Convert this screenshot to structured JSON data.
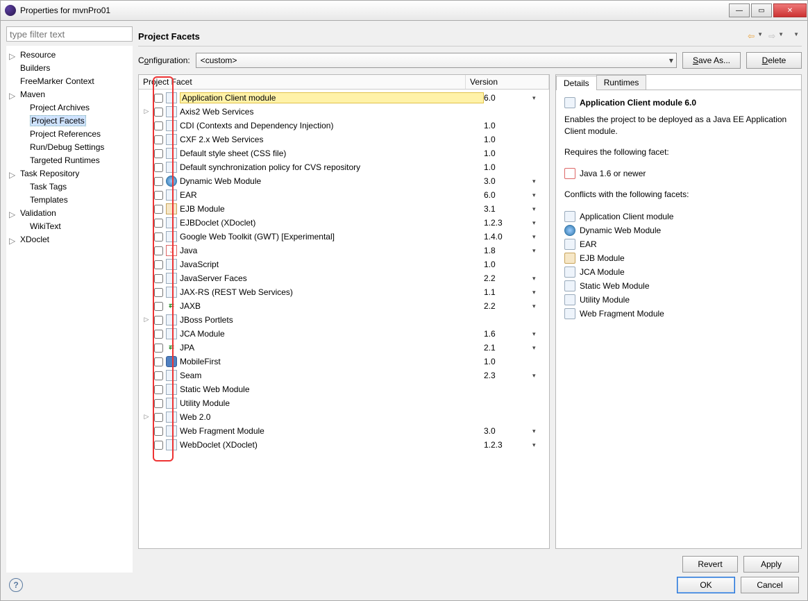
{
  "window": {
    "title": "Properties for mvnPro01"
  },
  "nav": {
    "filter_placeholder": "type filter text",
    "items": [
      {
        "label": "Resource",
        "expandable": true
      },
      {
        "label": "Builders"
      },
      {
        "label": "FreeMarker Context"
      },
      {
        "label": "Maven",
        "expandable": true
      },
      {
        "label": "Project Archives",
        "indent": true
      },
      {
        "label": "Project Facets",
        "indent": true,
        "selected": true
      },
      {
        "label": "Project References",
        "indent": true
      },
      {
        "label": "Run/Debug Settings",
        "indent": true
      },
      {
        "label": "Targeted Runtimes",
        "indent": true
      },
      {
        "label": "Task Repository",
        "expandable": true
      },
      {
        "label": "Task Tags",
        "indent": true
      },
      {
        "label": "Templates",
        "indent": true
      },
      {
        "label": "Validation",
        "expandable": true
      },
      {
        "label": "WikiText",
        "indent": true
      },
      {
        "label": "XDoclet",
        "expandable": true
      }
    ]
  },
  "header": {
    "title": "Project Facets"
  },
  "config": {
    "label_pre": "C",
    "label_u": "o",
    "label_post": "nfiguration:",
    "value": "<custom>",
    "save_pre": "",
    "save_u": "S",
    "save_post": "ave As...",
    "del_pre": "",
    "del_u": "D",
    "del_post": "elete"
  },
  "facets": {
    "col_facet": "Project Facet",
    "col_version": "Version",
    "rows": [
      {
        "name": "Application Client module",
        "ver": "6.0",
        "dd": true,
        "icon": "doc",
        "highlight": true
      },
      {
        "name": "Axis2 Web Services",
        "icon": "doc",
        "expandable": true
      },
      {
        "name": "CDI (Contexts and Dependency Injection)",
        "ver": "1.0",
        "icon": "doc"
      },
      {
        "name": "CXF 2.x Web Services",
        "ver": "1.0",
        "icon": "doc"
      },
      {
        "name": "Default style sheet (CSS file)",
        "ver": "1.0",
        "icon": "doc"
      },
      {
        "name": "Default synchronization policy for CVS repository",
        "ver": "1.0",
        "icon": "doc"
      },
      {
        "name": "Dynamic Web Module",
        "ver": "3.0",
        "dd": true,
        "icon": "globe"
      },
      {
        "name": "EAR",
        "ver": "6.0",
        "dd": true,
        "icon": "doc"
      },
      {
        "name": "EJB Module",
        "ver": "3.1",
        "dd": true,
        "icon": "jar"
      },
      {
        "name": "EJBDoclet (XDoclet)",
        "ver": "1.2.3",
        "dd": true,
        "icon": "doc"
      },
      {
        "name": "Google Web Toolkit (GWT) [Experimental]",
        "ver": "1.4.0",
        "dd": true,
        "icon": "doc"
      },
      {
        "name": "Java",
        "ver": "1.8",
        "dd": true,
        "icon": "java"
      },
      {
        "name": "JavaScript",
        "ver": "1.0",
        "icon": "doc"
      },
      {
        "name": "JavaServer Faces",
        "ver": "2.2",
        "dd": true,
        "icon": "doc"
      },
      {
        "name": "JAX-RS (REST Web Services)",
        "ver": "1.1",
        "dd": true,
        "icon": "doc"
      },
      {
        "name": "JAXB",
        "ver": "2.2",
        "dd": true,
        "icon": "arrow"
      },
      {
        "name": "JBoss Portlets",
        "icon": "doc",
        "expandable": true
      },
      {
        "name": "JCA Module",
        "ver": "1.6",
        "dd": true,
        "icon": "doc"
      },
      {
        "name": "JPA",
        "ver": "2.1",
        "dd": true,
        "icon": "arrow"
      },
      {
        "name": "MobileFirst",
        "ver": "1.0",
        "icon": "db"
      },
      {
        "name": "Seam",
        "ver": "2.3",
        "dd": true,
        "icon": "doc"
      },
      {
        "name": "Static Web Module",
        "icon": "doc"
      },
      {
        "name": "Utility Module",
        "icon": "doc"
      },
      {
        "name": "Web 2.0",
        "icon": "doc",
        "expandable": true
      },
      {
        "name": "Web Fragment Module",
        "ver": "3.0",
        "dd": true,
        "icon": "doc"
      },
      {
        "name": "WebDoclet (XDoclet)",
        "ver": "1.2.3",
        "dd": true,
        "icon": "doc"
      }
    ]
  },
  "details": {
    "tab_details": "Details",
    "tab_runtimes": "Runtimes",
    "title": "Application Client module 6.0",
    "desc": "Enables the project to be deployed as a Java EE Application Client module.",
    "requires_label": "Requires the following facet:",
    "requires": [
      {
        "name": "Java 1.6 or newer",
        "icon": "java"
      }
    ],
    "conflicts_label": "Conflicts with the following facets:",
    "conflicts": [
      {
        "name": "Application Client module",
        "icon": "doc"
      },
      {
        "name": "Dynamic Web Module",
        "icon": "globe"
      },
      {
        "name": "EAR",
        "icon": "doc"
      },
      {
        "name": "EJB Module",
        "icon": "jar"
      },
      {
        "name": "JCA Module",
        "icon": "doc"
      },
      {
        "name": "Static Web Module",
        "icon": "doc"
      },
      {
        "name": "Utility Module",
        "icon": "doc"
      },
      {
        "name": "Web Fragment Module",
        "icon": "doc"
      }
    ]
  },
  "buttons": {
    "revert": "Revert",
    "apply": "Apply",
    "ok": "OK",
    "cancel": "Cancel"
  }
}
